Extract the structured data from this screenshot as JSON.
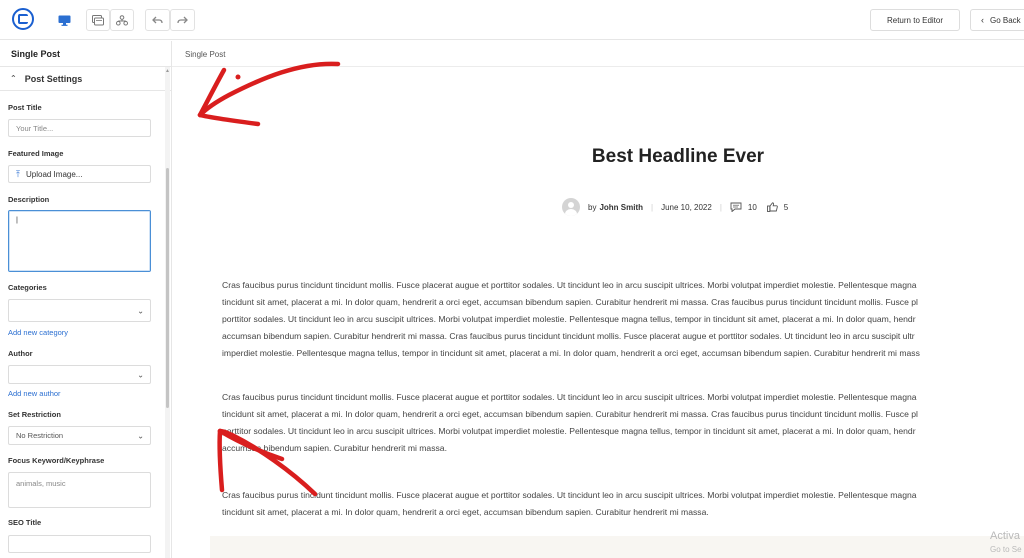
{
  "toolbar": {
    "logo_icon": "editor-logo-icon",
    "return_label": "Return to Editor",
    "goback_label": "Go Back"
  },
  "sidebar": {
    "title": "Single Post",
    "section_title": "Post Settings",
    "fields": {
      "post_title_label": "Post Title",
      "post_title_placeholder": "Your Title...",
      "featured_image_label": "Featured Image",
      "upload_label": "Upload Image...",
      "description_label": "Description",
      "description_value": "|",
      "categories_label": "Categories",
      "add_category_link": "Add new category",
      "author_label": "Author",
      "add_author_link": "Add new author",
      "restriction_label": "Set Restriction",
      "restriction_value": "No Restriction",
      "keyword_label": "Focus Keyword/Keyphrase",
      "keyword_value": "animals, music",
      "seo_title_label": "SEO Title"
    }
  },
  "main": {
    "breadcrumb": "Single Post",
    "headline": "Best Headline Ever",
    "meta": {
      "by": "by",
      "author": "John Smith",
      "date": "June 10, 2022",
      "comments": "10",
      "likes": "5"
    },
    "paragraphs": [
      [
        "Cras faucibus purus tincidunt tincidunt mollis. Fusce placerat augue et porttitor sodales. Ut tincidunt leo in arcu suscipit ultrices. Morbi volutpat imperdiet molestie. Pellentesque magna",
        "tincidunt sit amet, placerat a mi. In dolor quam, hendrerit a orci eget, accumsan bibendum sapien. Curabitur hendrerit mi massa. Cras faucibus purus tincidunt tincidunt mollis. Fusce pl",
        "porttitor sodales. Ut tincidunt leo in arcu suscipit ultrices. Morbi volutpat imperdiet molestie. Pellentesque magna tellus, tempor in tincidunt sit amet, placerat a mi. In dolor quam, hendr",
        "accumsan bibendum sapien. Curabitur hendrerit mi massa. Cras faucibus purus tincidunt tincidunt mollis. Fusce placerat augue et porttitor sodales. Ut tincidunt leo in arcu suscipit ultr",
        "imperdiet molestie. Pellentesque magna tellus, tempor in tincidunt sit amet, placerat a mi. In dolor quam, hendrerit a orci eget, accumsan bibendum sapien. Curabitur hendrerit mi mass"
      ],
      [
        "Cras faucibus purus tincidunt tincidunt mollis. Fusce placerat augue et porttitor sodales. Ut tincidunt leo in arcu suscipit ultrices. Morbi volutpat imperdiet molestie. Pellentesque magna",
        "tincidunt sit amet, placerat a mi. In dolor quam, hendrerit a orci eget, accumsan bibendum sapien. Curabitur hendrerit mi massa. Cras faucibus purus tincidunt tincidunt mollis. Fusce pl",
        "porttitor sodales. Ut tincidunt leo in arcu suscipit ultrices. Morbi volutpat imperdiet molestie. Pellentesque magna tellus, tempor in tincidunt sit amet, placerat a mi. In dolor quam, hendr",
        "accumsan bibendum sapien. Curabitur hendrerit mi massa."
      ],
      [
        "Cras faucibus purus tincidunt tincidunt mollis. Fusce placerat augue et porttitor sodales. Ut tincidunt leo in arcu suscipit ultrices. Morbi volutpat imperdiet molestie. Pellentesque magna",
        "tincidunt sit amet, placerat a mi. In dolor quam, hendrerit a orci eget, accumsan bibendum sapien. Curabitur hendrerit mi massa."
      ]
    ]
  },
  "watermark": {
    "line1": "Activa",
    "line2": "Go to Se"
  },
  "colors": {
    "accent": "#2b6fd1",
    "annotation_red": "#d91e1e"
  }
}
